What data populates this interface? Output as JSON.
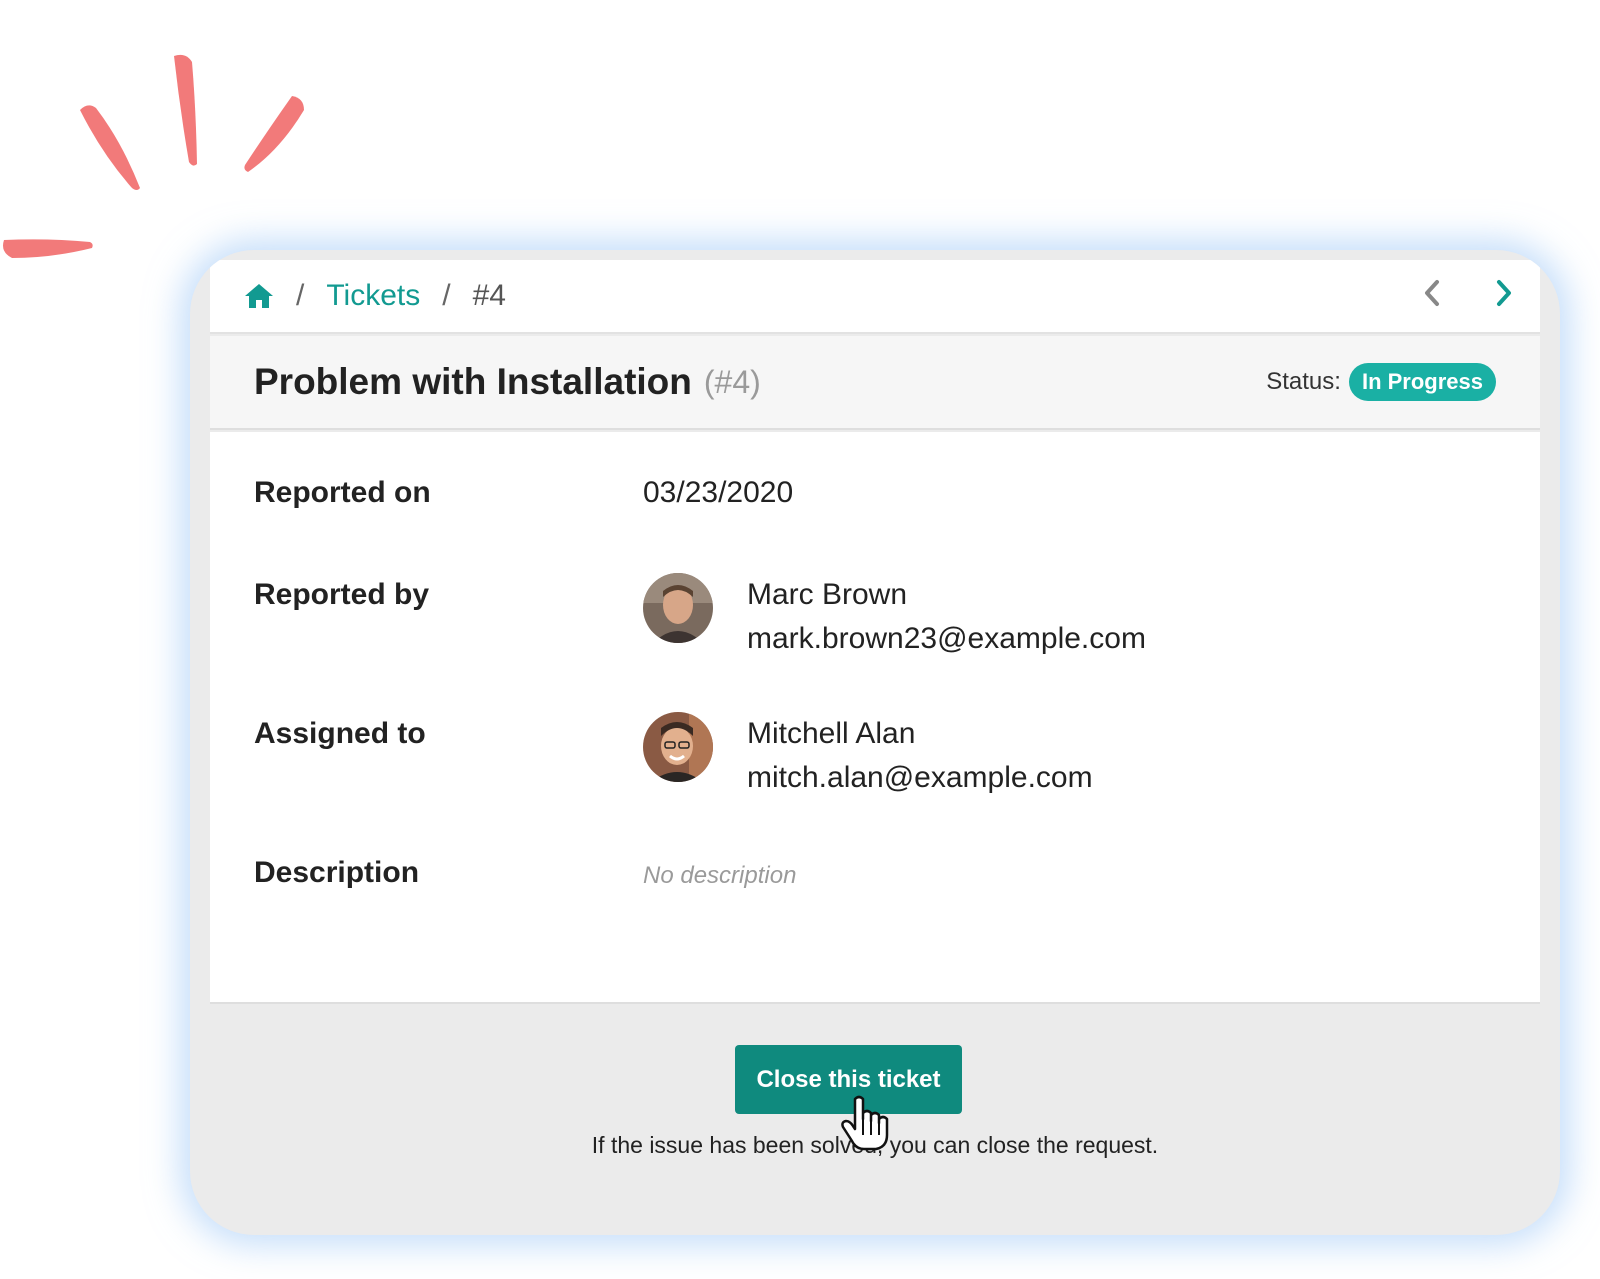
{
  "breadcrumb": {
    "home_icon": "home-icon",
    "separator": "/",
    "tickets": "Tickets",
    "current": "#4",
    "prev_icon": "chevron-left-icon",
    "next_icon": "chevron-right-icon"
  },
  "ticket": {
    "title": "Problem with Installation",
    "ref": "(#4)",
    "status_label": "Status:",
    "status": "In Progress"
  },
  "details": {
    "reported_on_label": "Reported on",
    "reported_on": "03/23/2020",
    "reported_by_label": "Reported by",
    "reporter_name": "Marc Brown",
    "reporter_email": "mark.brown23@example.com",
    "assigned_to_label": "Assigned to",
    "assignee_name": "Mitchell Alan",
    "assignee_email": "mitch.alan@example.com",
    "description_label": "Description",
    "description": "No description"
  },
  "footer": {
    "close_button": "Close this ticket",
    "hint": "If the issue has been solved, you can close the request."
  },
  "colors": {
    "accent": "#129a91",
    "button": "#0f8a7e",
    "badge": "#1ab0a4",
    "burst": "#f27a7a"
  }
}
